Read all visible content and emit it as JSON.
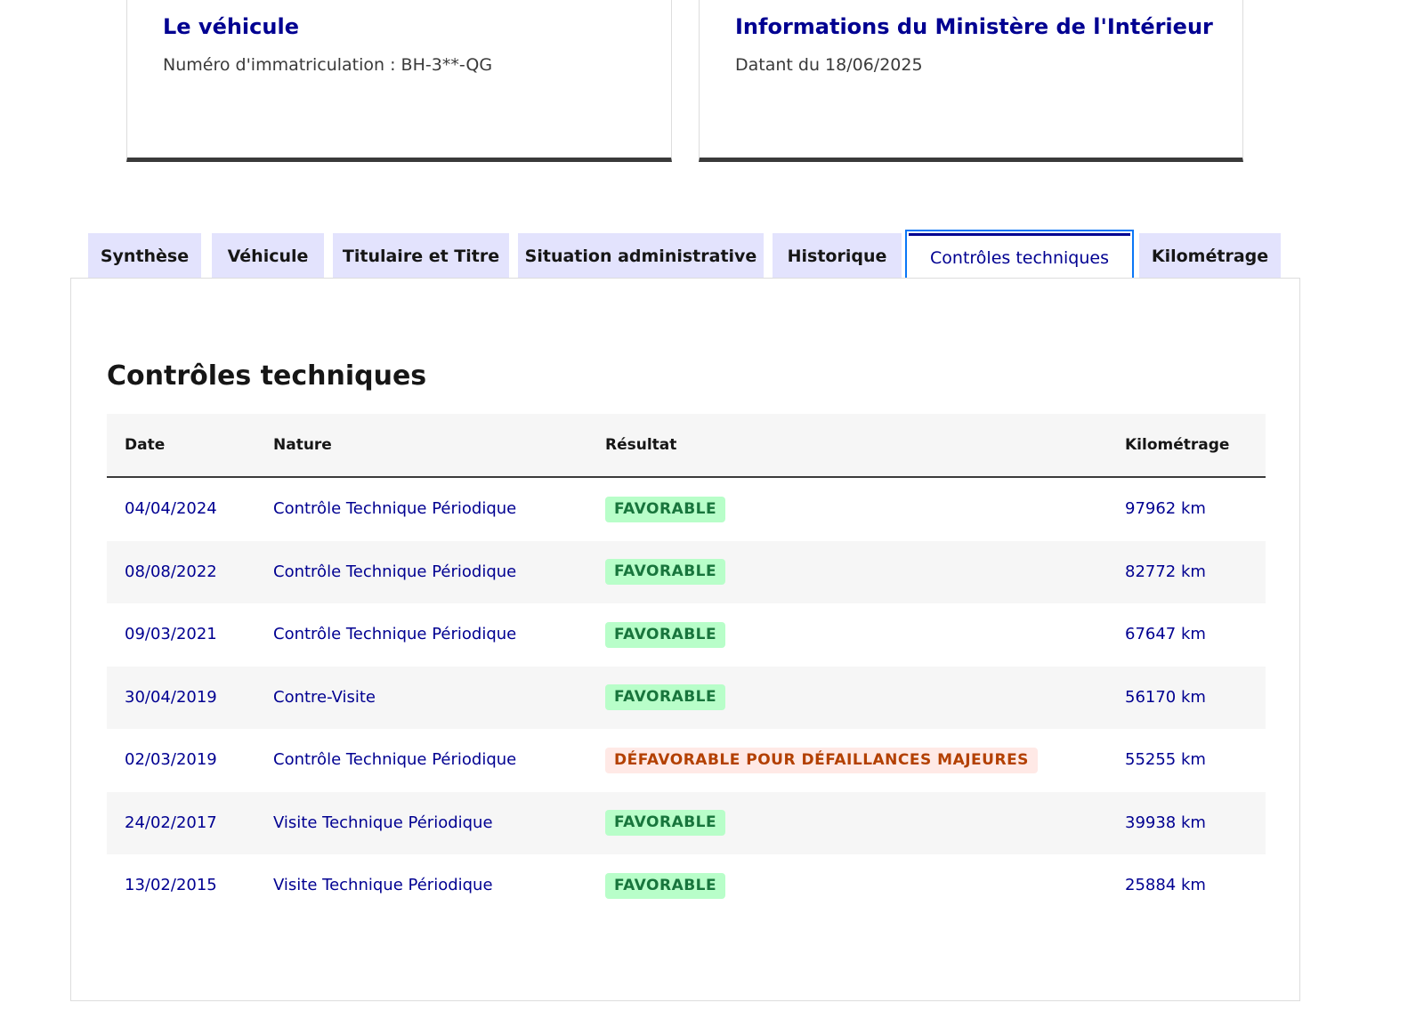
{
  "cards": {
    "vehicle": {
      "title": "Le véhicule",
      "subtitle": "Numéro d'immatriculation : BH-3**-QG"
    },
    "ministry": {
      "title": "Informations du Ministère de l'Intérieur",
      "subtitle": "Datant du 18/06/2025"
    }
  },
  "tabs": [
    {
      "label": "Synthèse",
      "active": false
    },
    {
      "label": "Véhicule",
      "active": false
    },
    {
      "label": "Titulaire et Titre",
      "active": false
    },
    {
      "label": "Situation administrative",
      "active": false
    },
    {
      "label": "Historique",
      "active": false
    },
    {
      "label": "Contrôles techniques",
      "active": true
    },
    {
      "label": "Kilométrage",
      "active": false
    }
  ],
  "section": {
    "title": "Contrôles techniques"
  },
  "table": {
    "columns": {
      "date": "Date",
      "nature": "Nature",
      "result": "Résultat",
      "mileage": "Kilométrage"
    },
    "rows": [
      {
        "date": "04/04/2024",
        "nature": "Contrôle Technique Périodique",
        "result": "FAVORABLE",
        "status": "ok",
        "mileage": "97962 km"
      },
      {
        "date": "08/08/2022",
        "nature": "Contrôle Technique Périodique",
        "result": "FAVORABLE",
        "status": "ok",
        "mileage": "82772 km"
      },
      {
        "date": "09/03/2021",
        "nature": "Contrôle Technique Périodique",
        "result": "FAVORABLE",
        "status": "ok",
        "mileage": "67647 km"
      },
      {
        "date": "30/04/2019",
        "nature": "Contre-Visite",
        "result": "FAVORABLE",
        "status": "ok",
        "mileage": "56170 km"
      },
      {
        "date": "02/03/2019",
        "nature": "Contrôle Technique Périodique",
        "result": "DÉFAVORABLE POUR DÉFAILLANCES MAJEURES",
        "status": "ko",
        "mileage": "55255 km"
      },
      {
        "date": "24/02/2017",
        "nature": "Visite Technique Périodique",
        "result": "FAVORABLE",
        "status": "ok",
        "mileage": "39938 km"
      },
      {
        "date": "13/02/2015",
        "nature": "Visite Technique Périodique",
        "result": "FAVORABLE",
        "status": "ok",
        "mileage": "25884 km"
      }
    ]
  },
  "colors": {
    "primary": "#000091",
    "tab_background": "#e3e3fd",
    "focus_outline": "#0a76f6",
    "success_bg": "#b8fec9",
    "success_text": "#18753c",
    "error_bg": "#ffe9e6",
    "error_text": "#b34000"
  }
}
